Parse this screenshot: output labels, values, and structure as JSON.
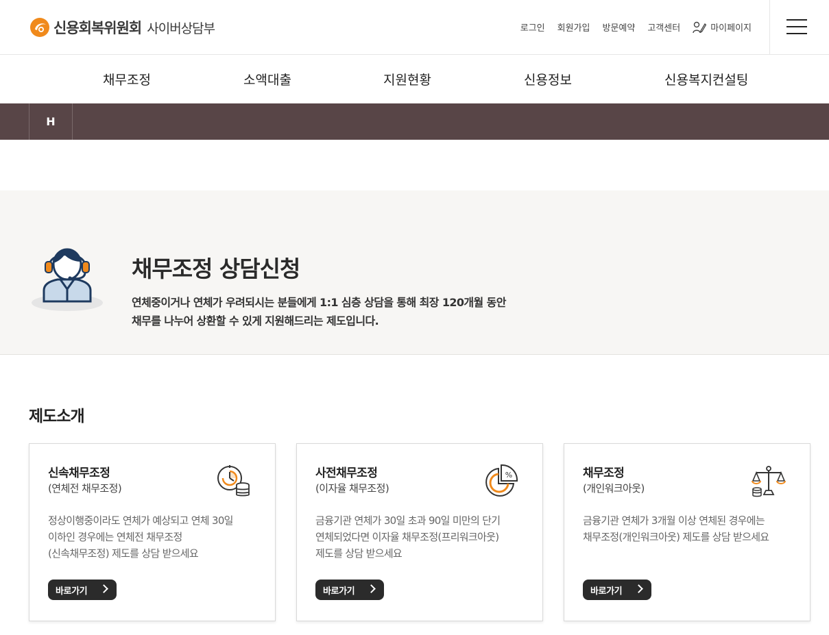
{
  "header": {
    "logo_main": "신용회복위원회",
    "logo_sub": "사이버상담부",
    "util_links": [
      "로그인",
      "회원가입",
      "방문예약",
      "고객센터"
    ],
    "mypage_label": "마이페이지",
    "brand_color": "#F08A1C"
  },
  "gnb": [
    "채무조정",
    "소액대출",
    "지원현황",
    "신용정보",
    "신용복지컨설팅"
  ],
  "location": {
    "home": "H",
    "bar_color": "#584547"
  },
  "intro": {
    "title": "채무조정 상담신청",
    "desc_line1": "연체중이거나 연체가 우려되시는 분들에게 1:1 심층 상담을 통해 최장 120개월 동안",
    "desc_line2": "채무를 나누어 상환할 수 있게 지원해드리는 제도입니다."
  },
  "section": {
    "title": "제도소개"
  },
  "cards": [
    {
      "title": "신속채무조정",
      "subtitle": "(연체전 채무조정)",
      "icon": "clock-coins-icon",
      "desc": [
        "정상이행중이라도 연체가 예상되고 연체 30일",
        "이하인 경우에는 연체전 채무조정",
        "(신속채무조정) 제도를 상담 받으세요"
      ],
      "button": "바로가기"
    },
    {
      "title": "사전채무조정",
      "subtitle": "(이자율 채무조정)",
      "icon": "percent-pie-icon",
      "desc": [
        "금융기관 연체가 30일 초과 90일 미만의 단기",
        "연체되었다면 이자율 채무조정(프리워크아웃)",
        "제도를 상담 받으세요"
      ],
      "button": "바로가기"
    },
    {
      "title": "채무조정",
      "subtitle": "(개인워크아웃)",
      "icon": "balance-scale-icon",
      "desc": [
        "금융기관 연체가 3개월 이상 연체된 경우에는",
        "채무조정(개인워크아웃) 제도를 상담 받으세요"
      ],
      "button": "바로가기"
    }
  ]
}
